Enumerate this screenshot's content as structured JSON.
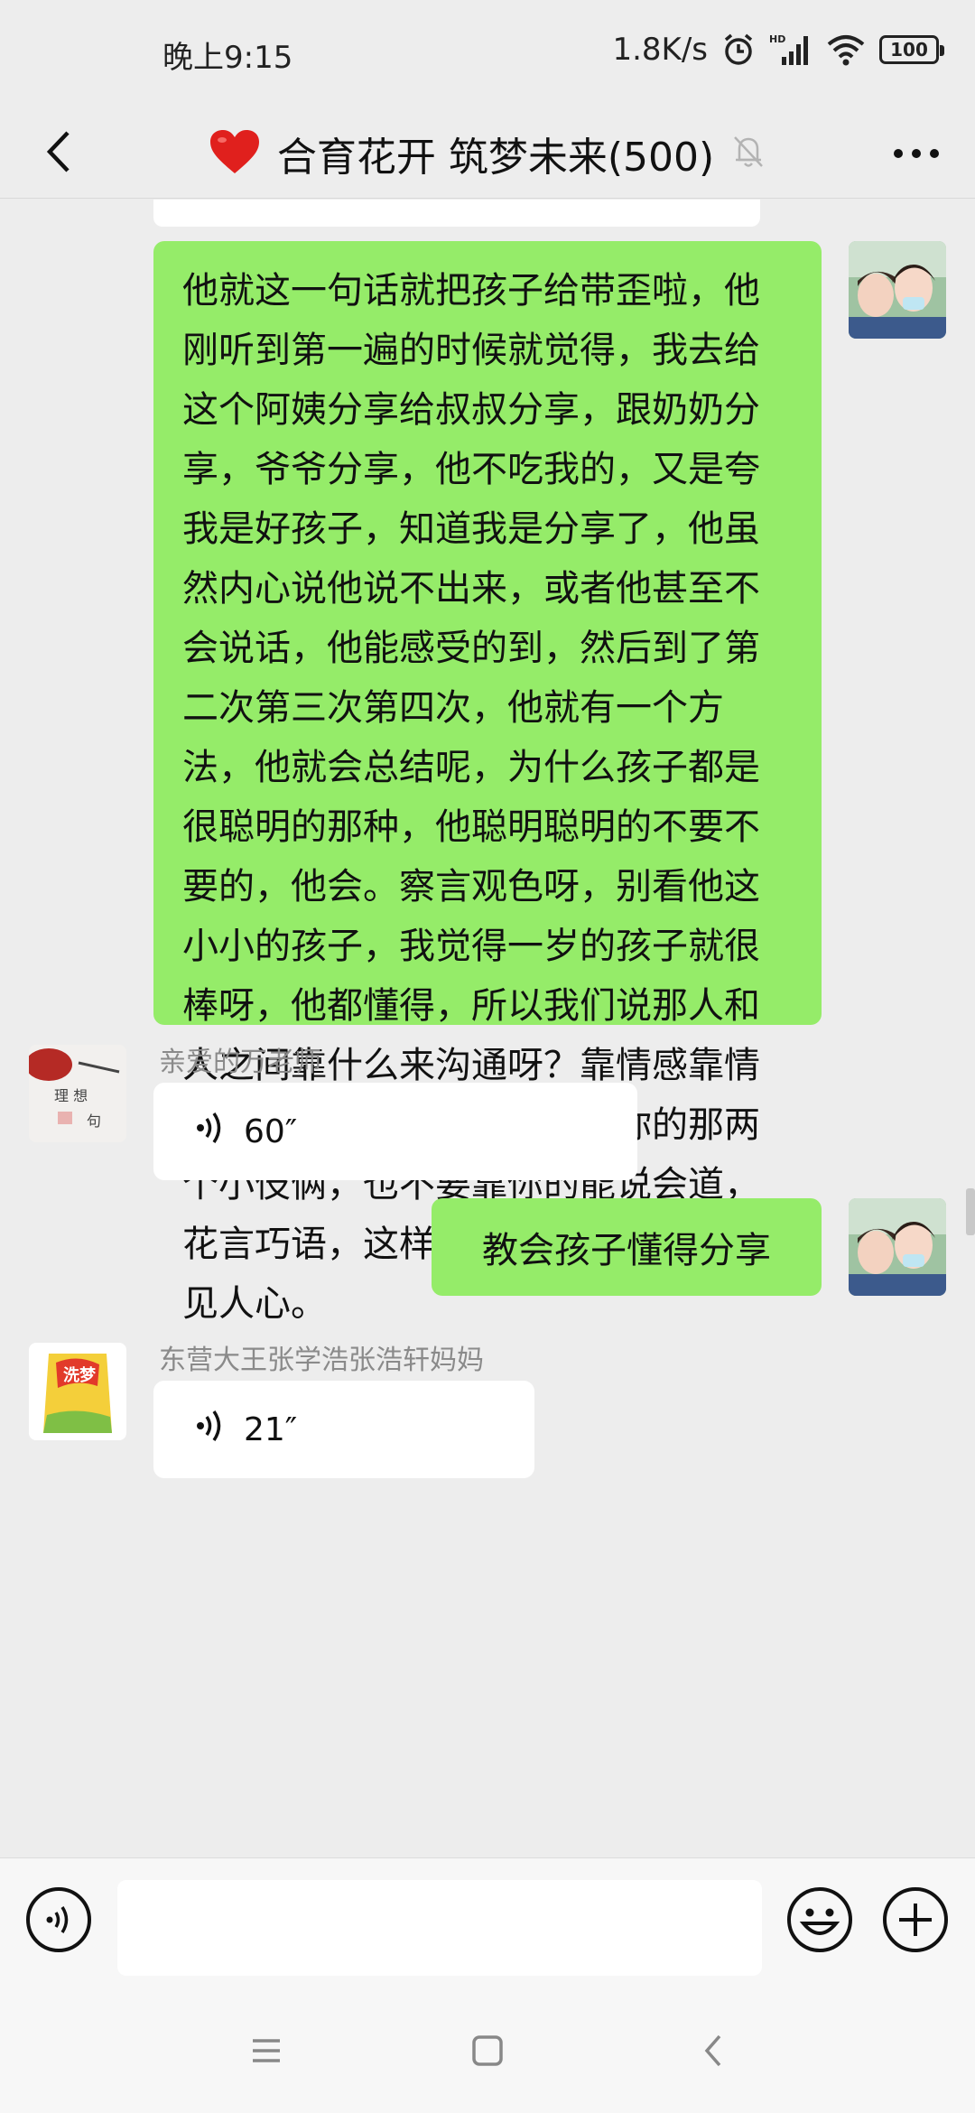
{
  "status_bar": {
    "time": "晚上9:15",
    "net_speed": "1.8K/s",
    "battery": "100",
    "icons": [
      "alarm-icon",
      "hd-signal-icon",
      "wifi-icon",
      "battery-icon"
    ]
  },
  "header": {
    "emoji": "❤️",
    "title": "合育花开 筑梦未来(500)",
    "icons": [
      "back-chevron-icon",
      "mute-bell-icon",
      "more-dots-icon"
    ]
  },
  "messages": [
    {
      "side": "right",
      "type": "text",
      "text": "他就这一句话就把孩子给带歪啦，他刚听到第一遍的时候就觉得，我去给这个阿姨分享给叔叔分享，跟奶奶分享，爷爷分享，他不吃我的，又是夸我是好孩子，知道我是分享了，他虽然内心说他说不出来，或者他甚至不会说话，他能感受的到，然后到了第二次第三次第四次，他就有一个方法，他就会总结呢，为什么孩子都是很聪明的那种，他聪明聪明的不要不要的，他会。察言观色呀，别看他这小小的孩子，我觉得一岁的孩子就很棒呀，他都懂得，所以我们说那人和人之间靠什么来沟通呀？靠情感靠情感，这是最重要的，不要靠你的那两个小伎俩，也不要靠你的能说会道，花言巧语，这样的人是不长久的日久见人心。"
    },
    {
      "side": "left",
      "type": "voice",
      "sender": "亲爱的万老师",
      "duration": "60″"
    },
    {
      "side": "right",
      "type": "text",
      "text": "教会孩子懂得分享"
    },
    {
      "side": "left",
      "type": "voice",
      "sender": "东营大王张学浩张浩轩妈妈",
      "duration": "21″"
    }
  ],
  "input_bar": {
    "placeholder": "",
    "icons": [
      "voice-mode-icon",
      "emoji-icon",
      "plus-icon"
    ]
  },
  "nav_bar": {
    "icons": [
      "menu-icon",
      "home-icon",
      "back-icon"
    ]
  },
  "colors": {
    "background": "#ededed",
    "bubble_self": "#95ec69",
    "bubble_other": "#ffffff",
    "sender_name": "#8a8a8a"
  }
}
